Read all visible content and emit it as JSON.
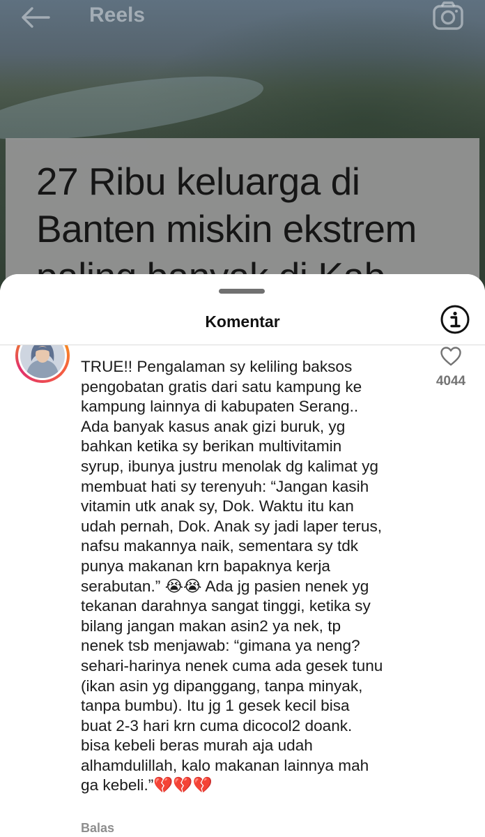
{
  "header": {
    "title": "Reels",
    "back_icon": "back-arrow-icon",
    "camera_icon": "camera-icon"
  },
  "reel": {
    "caption": "27 Ribu keluarga di\nBanten miskin ekstrem\npaling banyak di Kab"
  },
  "comments_sheet": {
    "title": "Komentar",
    "info_icon": "info-icon"
  },
  "comment": {
    "text": "TRUE!! Pengalaman sy keliling baksos\npengobatan gratis dari satu kampung ke\nkampung lainnya di kabupaten Serang..\nAda banyak kasus anak gizi buruk, yg\nbahkan ketika sy berikan multivitamin\nsyrup, ibunya justru menolak dg kalimat yg\nmembuat hati sy terenyuh: “Jangan kasih\nvitamin utk anak sy, Dok. Waktu itu kan\nudah pernah, Dok. Anak sy jadi laper terus,\nnafsu makannya naik, sementara sy tdk\npunya makanan krn bapaknya kerja\nserabutan.” 😭😭 Ada jg pasien nenek yg\ntekanan darahnya sangat tinggi, ketika sy\nbilang jangan makan asin2 ya nek, tp\nnenek tsb menjawab: “gimana ya neng?\nsehari-harinya nenek cuma ada gesek tunu\n(ikan asin yg dipanggang, tanpa minyak,\ntanpa bumbu). Itu jg 1 gesek kecil bisa\nbuat 2-3 hari krn cuma dicocol2 doank.\nbisa kebeli beras murah aja udah\nalhamdulillah, kalo makanan lainnya mah\nga kebeli.”💔💔💔",
    "like_count": "4044",
    "reply_label": "Balas"
  },
  "colors": {
    "sheet_bg": "#ffffff",
    "text_primary": "#1a1a1a",
    "text_secondary": "#737373",
    "story_ring": [
      "#f7b500",
      "#f56040",
      "#e1306c"
    ]
  }
}
